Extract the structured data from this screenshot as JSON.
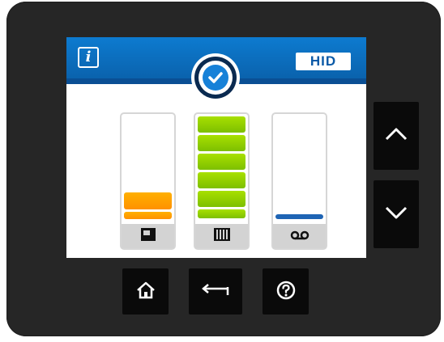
{
  "header": {
    "logo_text": "HID",
    "info_icon": "info-icon",
    "status_icon": "check-circle-icon"
  },
  "gauges": [
    {
      "name": "ink-cartridge",
      "icon": "card-cartridge-icon",
      "level_segments": 2,
      "max_segments": 6,
      "color": "#ff9a00"
    },
    {
      "name": "film-ribbon",
      "icon": "film-icon",
      "level_segments": 6,
      "max_segments": 6,
      "color": "#94d000"
    },
    {
      "name": "cleaning-roller",
      "icon": "tape-icon",
      "level_segments": 1,
      "max_segments": 6,
      "color": "#1e64b4"
    }
  ],
  "side_buttons": [
    "chevron-up-icon",
    "chevron-down-icon"
  ],
  "bottom_buttons": [
    "home-icon",
    "back-arrow-icon",
    "help-icon"
  ],
  "colors": {
    "header_blue": "#0b6cc0",
    "device_body": "#262626",
    "button_black": "#0a0a0a"
  }
}
